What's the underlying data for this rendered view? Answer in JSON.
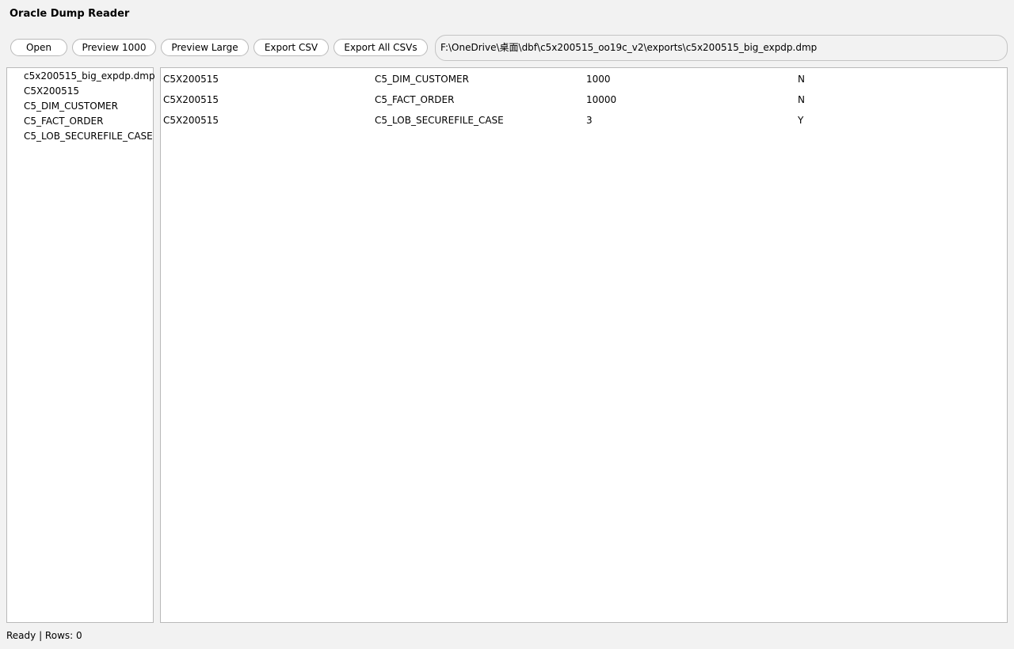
{
  "app": {
    "title": "Oracle Dump Reader"
  },
  "toolbar": {
    "open_label": "Open",
    "preview_1000_label": "Preview 1000",
    "preview_large_label": "Preview Large",
    "export_csv_label": "Export CSV",
    "export_all_label": "Export All CSVs"
  },
  "path": {
    "value": "F:\\OneDrive\\桌面\\dbf\\c5x200515_oo19c_v2\\exports\\c5x200515_big_expdp.dmp"
  },
  "tree": {
    "items": [
      {
        "label": "c5x200515_big_expdp.dmp"
      },
      {
        "label": "C5X200515"
      },
      {
        "label": "C5_DIM_CUSTOMER"
      },
      {
        "label": "C5_FACT_ORDER"
      },
      {
        "label": "C5_LOB_SECUREFILE_CASE"
      }
    ]
  },
  "table": {
    "rows": [
      [
        "C5X200515",
        "C5_DIM_CUSTOMER",
        "1000",
        "N"
      ],
      [
        "C5X200515",
        "C5_FACT_ORDER",
        "10000",
        "N"
      ],
      [
        "C5X200515",
        "C5_LOB_SECUREFILE_CASE",
        "3",
        "Y"
      ]
    ]
  },
  "status": {
    "text": "Ready | Rows: 0"
  }
}
